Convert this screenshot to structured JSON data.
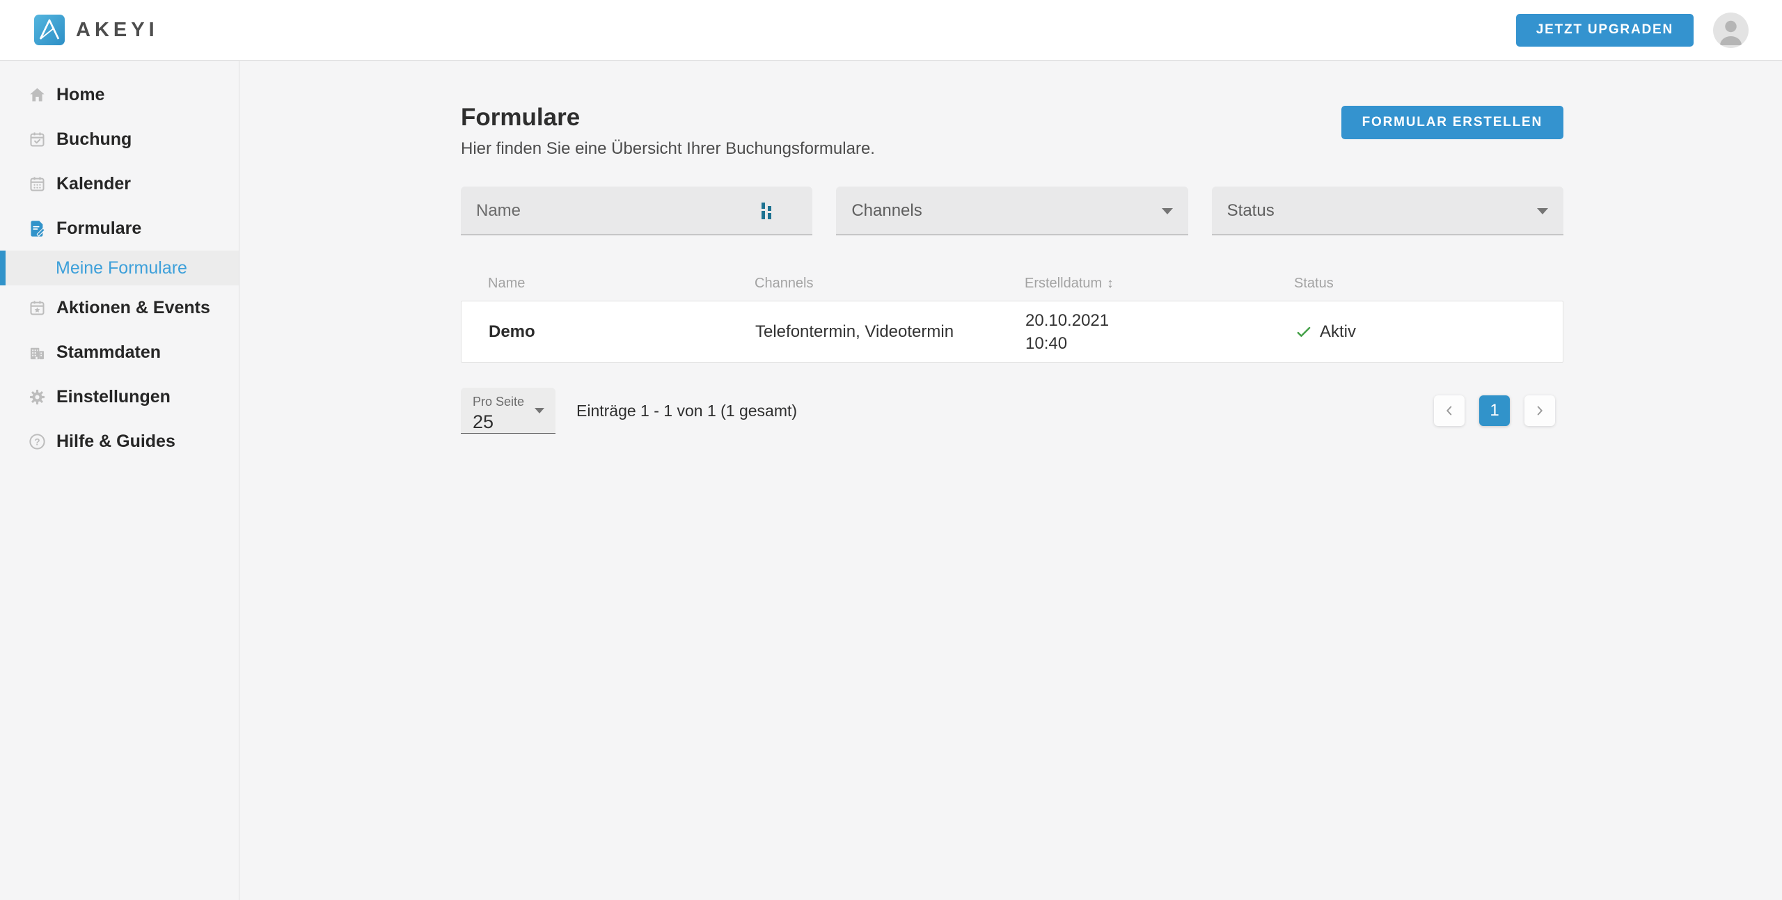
{
  "header": {
    "logo_text": "AKEYI",
    "upgrade_button": "JETZT UPGRADEN"
  },
  "sidebar": {
    "items": [
      {
        "label": "Home",
        "icon": "home-icon"
      },
      {
        "label": "Buchung",
        "icon": "calendar-check-icon"
      },
      {
        "label": "Kalender",
        "icon": "calendar-icon"
      },
      {
        "label": "Formulare",
        "icon": "form-icon",
        "active": true
      },
      {
        "label": "Meine Formulare",
        "sub_item": true,
        "active": true
      },
      {
        "label": "Aktionen & Events",
        "icon": "calendar-star-icon"
      },
      {
        "label": "Stammdaten",
        "icon": "building-icon"
      },
      {
        "label": "Einstellungen",
        "icon": "gear-icon"
      },
      {
        "label": "Hilfe & Guides",
        "icon": "help-icon"
      }
    ]
  },
  "page": {
    "title": "Formulare",
    "subtitle": "Hier finden Sie eine Übersicht Ihrer Buchungsformulare.",
    "create_button": "FORMULAR ERSTELLEN"
  },
  "filters": {
    "name": {
      "placeholder": "Name"
    },
    "channels": {
      "label": "Channels"
    },
    "status": {
      "label": "Status"
    }
  },
  "table": {
    "columns": [
      "Name",
      "Channels",
      "Erstelldatum",
      "Status"
    ],
    "sort_icon": "↕",
    "rows": [
      {
        "name": "Demo",
        "channels": "Telefontermin, Videotermin",
        "date": "20.10.2021",
        "time": "10:40",
        "status": "Aktiv"
      }
    ]
  },
  "pagination": {
    "per_page_label": "Pro Seite",
    "per_page_value": "25",
    "entries_text": "Einträge 1 - 1 von 1 (1 gesamt)",
    "current_page": "1"
  },
  "colors": {
    "accent_blue": "#3493cf",
    "active_link_blue": "#3da0da",
    "status_green": "#43a047",
    "cursor_icon_teal": "#1d7291"
  }
}
